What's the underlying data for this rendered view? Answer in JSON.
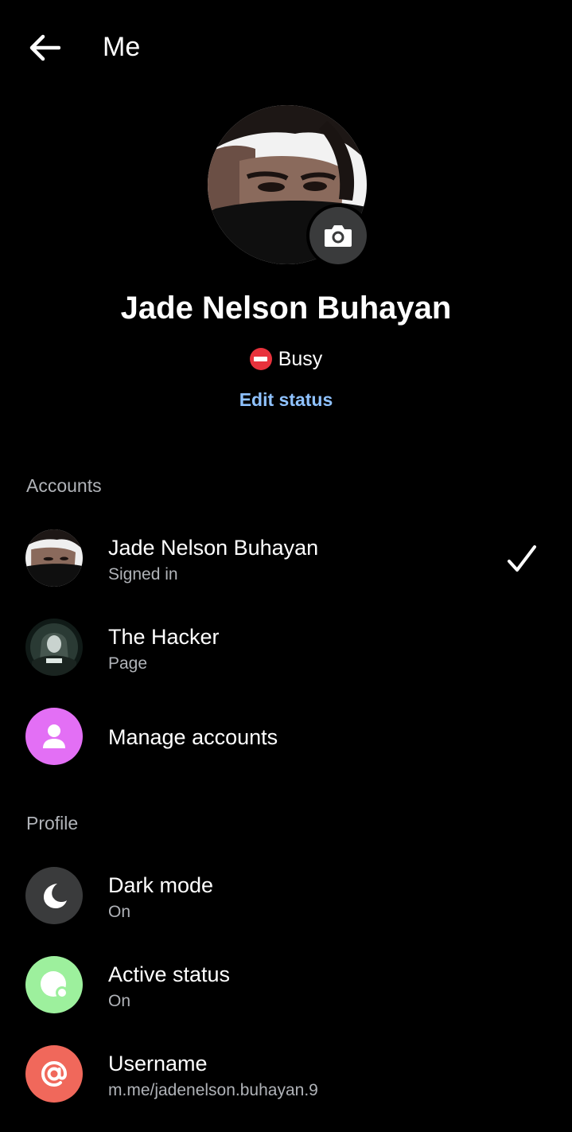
{
  "header": {
    "title": "Me",
    "back_icon": "arrow-left-icon"
  },
  "profile": {
    "name": "Jade Nelson Buhayan",
    "status": "Busy",
    "status_icon": "do-not-disturb-icon",
    "edit_status_label": "Edit status",
    "camera_icon": "camera-icon"
  },
  "accounts": {
    "section_label": "Accounts",
    "items": [
      {
        "title": "Jade Nelson Buhayan",
        "subtitle": "Signed in",
        "selected": true,
        "check_icon": "checkmark-icon"
      },
      {
        "title": "The Hacker",
        "subtitle": "Page"
      },
      {
        "title": "Manage accounts",
        "icon": "person-icon"
      }
    ]
  },
  "profile_section": {
    "section_label": "Profile",
    "items": [
      {
        "title": "Dark mode",
        "subtitle": "On",
        "icon": "moon-icon"
      },
      {
        "title": "Active status",
        "subtitle": "On",
        "icon": "active-status-icon"
      },
      {
        "title": "Username",
        "subtitle": "m.me/jadenelson.buhayan.9",
        "icon": "at-sign-icon"
      }
    ]
  },
  "colors": {
    "background": "#000000",
    "link": "#8fc2ff",
    "secondary_text": "#b0b3b8",
    "busy_red": "#e8323c",
    "manage_accounts_purple": "#e36ff5",
    "dark_mode_gray": "#3a3b3c",
    "active_status_green": "#9df09d",
    "username_red": "#f0685b"
  }
}
